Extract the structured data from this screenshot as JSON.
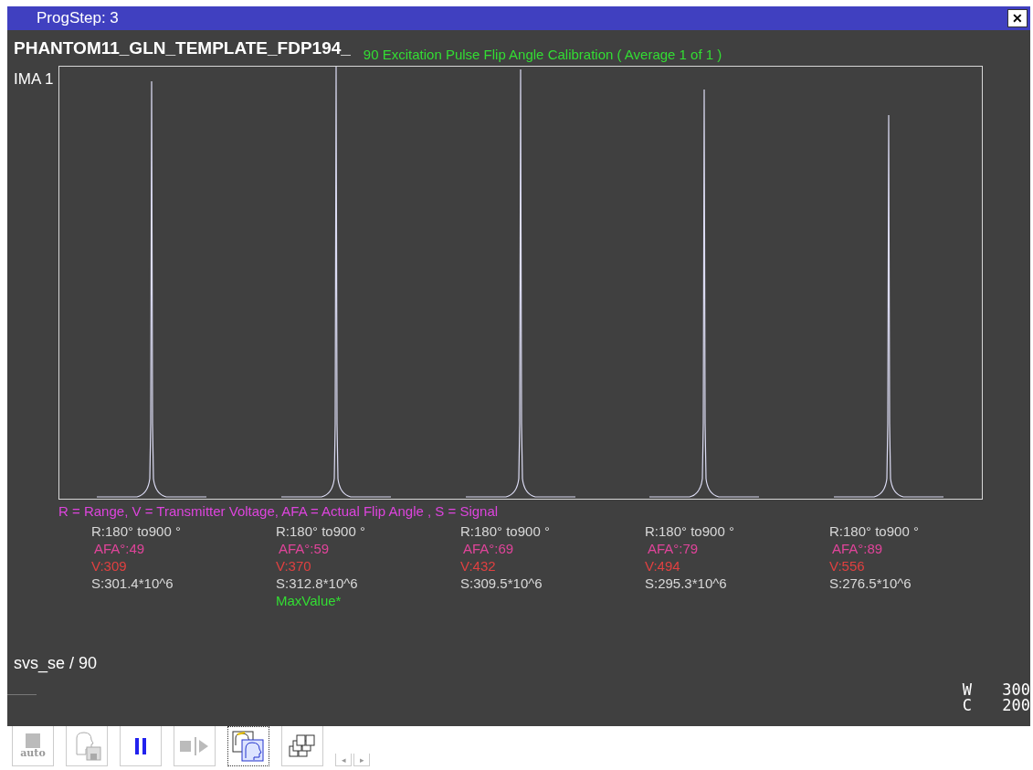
{
  "window": {
    "title": "ProgStep: 3",
    "close": "✕"
  },
  "header": {
    "protocol": "PHANTOM11_GLN_TEMPLATE_FDP194_",
    "chart_title": "90 Excitation Pulse Flip Angle Calibration ( Average 1 of 1 )",
    "image_label": "IMA 1"
  },
  "legend": "R = Range, V = Transmitter Voltage, AFA = Actual Flip Angle , S = Signal",
  "results": [
    {
      "range": "R:180° to900 °",
      "afa": "AFA°:49",
      "voltage": "V:309",
      "signal": "S:301.4*10^6",
      "max": false
    },
    {
      "range": "R:180° to900 °",
      "afa": "AFA°:59",
      "voltage": "V:370",
      "signal": "S:312.8*10^6",
      "max": true,
      "max_label": "MaxValue*"
    },
    {
      "range": "R:180° to900 °",
      "afa": "AFA°:69",
      "voltage": "V:432",
      "signal": "S:309.5*10^6",
      "max": false
    },
    {
      "range": "R:180° to900 °",
      "afa": "AFA°:79",
      "voltage": "V:494",
      "signal": "S:295.3*10^6",
      "max": false
    },
    {
      "range": "R:180° to900 °",
      "afa": "AFA°:89",
      "voltage": "V:556",
      "signal": "S:276.5*10^6",
      "max": false
    }
  ],
  "sequence": "svs_se / 90",
  "window_level": [
    {
      "label": "W",
      "value": "300"
    },
    {
      "label": "C",
      "value": "200"
    }
  ],
  "toolbar": [
    {
      "kind": "auto",
      "label": "auto",
      "disabled": true,
      "selected": false
    },
    {
      "kind": "save",
      "disabled": true,
      "selected": false
    },
    {
      "kind": "pause",
      "disabled": false,
      "selected": false
    },
    {
      "kind": "step",
      "disabled": true,
      "selected": false
    },
    {
      "kind": "view",
      "disabled": false,
      "selected": true
    },
    {
      "kind": "stack",
      "disabled": false,
      "selected": false
    }
  ],
  "scroll": [
    "◂",
    "▸"
  ]
}
